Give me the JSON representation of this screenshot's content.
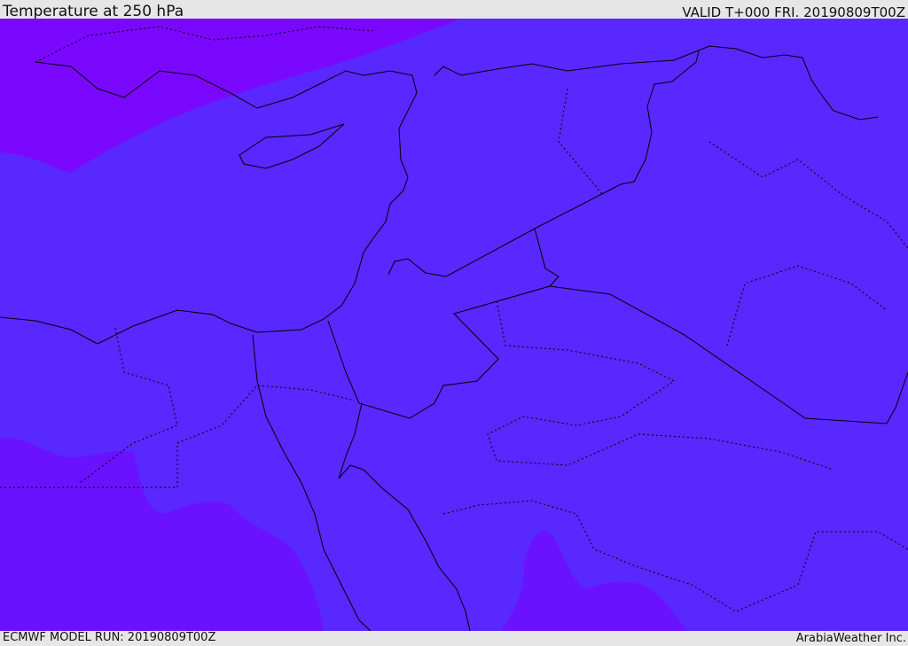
{
  "header": {
    "title": "Temperature at 250 hPa",
    "valid": "VALID T+000 FRI. 20190809T00Z"
  },
  "footer": {
    "model_run": "ECMWF MODEL RUN: 20190809T00Z",
    "credit": "ArabiaWeather Inc."
  },
  "map": {
    "variable": "Temperature",
    "level": "250 hPa",
    "colors": {
      "base": "#5828ff",
      "colder_nw": "#7a08ff",
      "colder_sw": "#6a12ff",
      "border": "#000000"
    }
  }
}
